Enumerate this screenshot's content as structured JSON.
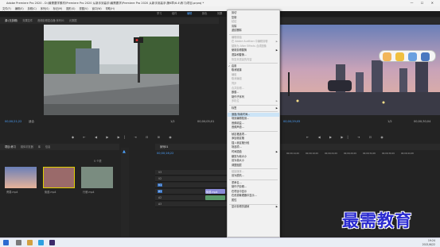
{
  "window": {
    "title": "Adobe Premiere Pro 2020 - D:\\最需要学素材\\Premiere Pro 2020 从新手到高手\\最需要学\\Premiere Pro 2020 从新手到高手\\第6章\\6.4\\练习\\项目.prproj *",
    "controls": "— ☐ ✕"
  },
  "menubar": [
    "文件(F)",
    "编辑(E)",
    "剪辑(C)",
    "序列(S)",
    "标记(M)",
    "图形(G)",
    "视图(V)",
    "窗口(W)",
    "帮助(H)"
  ],
  "workspaces": [
    "学习",
    "组件",
    "编辑",
    "颜色",
    "效果",
    "音频",
    "图形",
    "库"
  ],
  "workspace_active": "编辑",
  "source_monitor": {
    "tabs": [
      "源:(无剪辑)",
      "效果控件",
      "音频剪辑混合器:序列01",
      "元数据"
    ],
    "timecode": "00;00;21;22",
    "zoom": "适合",
    "page": "1/2",
    "duration": "00;00;05;01"
  },
  "program_monitor": {
    "timecode": "00;00;29;05",
    "page": "1/2",
    "duration": "00;00;30;04"
  },
  "project_panel": {
    "tabs": [
      "项目:练习",
      "媒体浏览器",
      "库",
      "信息"
    ],
    "count": "5 个项",
    "clips": [
      {
        "name": "黄昏.mp4",
        "duration": "5:01"
      },
      {
        "name": "街道.mp4",
        "duration": "10:00"
      },
      {
        "name": "行驶.mp4",
        "duration": "10:12"
      }
    ]
  },
  "timeline": {
    "tab": "序列01",
    "timecode": "00;00;16;22",
    "ruler": [
      "00;00;14;29",
      "00;00;19;29",
      "00;00;24;29",
      "00;00;29;29",
      "00;00;34;28",
      "00;00;39;29",
      "00;00;44;28"
    ],
    "tracks": [
      "V3",
      "V2",
      "V1",
      "A1",
      "A2",
      "A3"
    ],
    "clip_label": "街道.mp4"
  },
  "context_menu": {
    "items": [
      {
        "label": "剪切",
        "disabled": false
      },
      {
        "label": "复制",
        "disabled": false
      },
      {
        "label": "粘贴",
        "disabled": true
      },
      {
        "label": "清除",
        "disabled": false
      },
      {
        "label": "波纹删除",
        "disabled": false
      },
      {
        "sep": true
      },
      {
        "label": "编辑原始",
        "disabled": true
      },
      {
        "label": "在 Adobe Audition 中编辑剪辑",
        "disabled": true,
        "arrow": true
      },
      {
        "label": "替换为 After Effects 合成图像",
        "disabled": true
      },
      {
        "label": "使用剪辑替换",
        "disabled": false,
        "arrow": true
      },
      {
        "label": "渲染和替换...",
        "disabled": false
      },
      {
        "label": "恢复未渲染的内容",
        "disabled": true
      },
      {
        "sep": true
      },
      {
        "label": "启用",
        "disabled": false,
        "check": true
      },
      {
        "label": "取消链接",
        "disabled": false
      },
      {
        "label": "编组",
        "disabled": true
      },
      {
        "label": "取消编组",
        "disabled": true
      },
      {
        "label": "同步",
        "disabled": true
      },
      {
        "label": "合并剪辑...",
        "disabled": true
      },
      {
        "label": "嵌套...",
        "disabled": false
      },
      {
        "label": "制作子序列",
        "disabled": false
      },
      {
        "label": "多机位",
        "disabled": true,
        "arrow": true
      },
      {
        "sep": true
      },
      {
        "label": "标签",
        "disabled": false,
        "arrow": true
      },
      {
        "sep": true
      },
      {
        "label": "速度/持续时间...",
        "disabled": false,
        "highlight": true
      },
      {
        "label": "场景编辑检测...",
        "disabled": false
      },
      {
        "label": "音频增益...",
        "disabled": false
      },
      {
        "label": "音频声道...",
        "disabled": false
      },
      {
        "sep": true
      },
      {
        "label": "帧定格选项...",
        "disabled": false
      },
      {
        "label": "添加帧定格",
        "disabled": false
      },
      {
        "label": "插入帧定格分段",
        "disabled": false
      },
      {
        "label": "场选项...",
        "disabled": false
      },
      {
        "label": "时间插值",
        "disabled": false,
        "arrow": true
      },
      {
        "label": "缩放为帧大小",
        "disabled": false
      },
      {
        "label": "设为帧大小",
        "disabled": false
      },
      {
        "label": "调整图层",
        "disabled": false
      },
      {
        "sep": true
      },
      {
        "label": "链接媒体...",
        "disabled": true
      },
      {
        "label": "设为脱机...",
        "disabled": false
      },
      {
        "sep": true
      },
      {
        "label": "重命名...",
        "disabled": false
      },
      {
        "label": "制作子剪辑...",
        "disabled": false
      },
      {
        "label": "在项目中显示",
        "disabled": false
      },
      {
        "label": "在资源管理器中显示...",
        "disabled": false
      },
      {
        "label": "属性",
        "disabled": false
      },
      {
        "sep": true
      },
      {
        "label": "显示剪辑关键帧",
        "disabled": false,
        "arrow": true
      }
    ]
  },
  "taskbar": {
    "time": "19:24",
    "date": "2021/6/22"
  },
  "watermark": "最需教育",
  "colors": {
    "accent": "#4da3ff",
    "menu_highlight": "#cce4f7",
    "clip_blue": "#8a8ad8",
    "clip_green": "#5a9a6a",
    "watermark": "#2a2ad0"
  }
}
